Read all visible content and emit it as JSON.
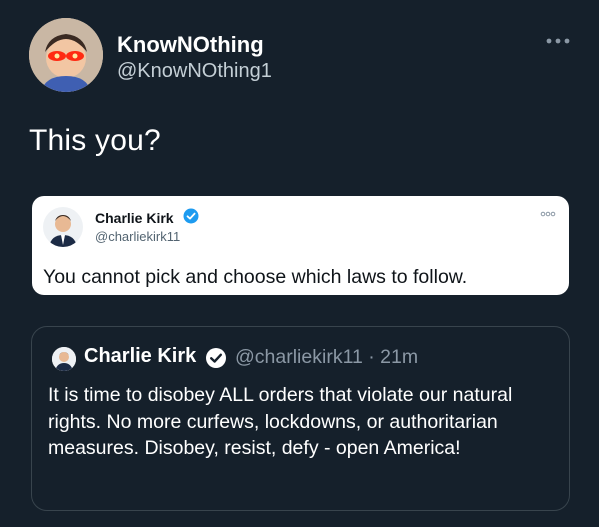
{
  "author": {
    "name": "KnowNOthing",
    "handle": "@KnowNOthing1",
    "avatar_icon": "glowing-eyes-avatar-icon"
  },
  "tweet_text": "This you?",
  "screenshot_tweet": {
    "name": "Charlie Kirk",
    "handle": "@charliekirk11",
    "text": "You cannot pick and choose which laws to follow."
  },
  "quoted_tweet": {
    "name": "Charlie Kirk",
    "meta": "@charliekirk11 · 21m",
    "text": "It is time to disobey ALL orders that violate our natural rights. No more curfews, lockdowns, or authoritarian measures. Disobey, resist, defy - open America!"
  },
  "colors": {
    "background": "#15202b",
    "verified": "#1d9bf0",
    "secondary_text": "#8b98a5"
  }
}
